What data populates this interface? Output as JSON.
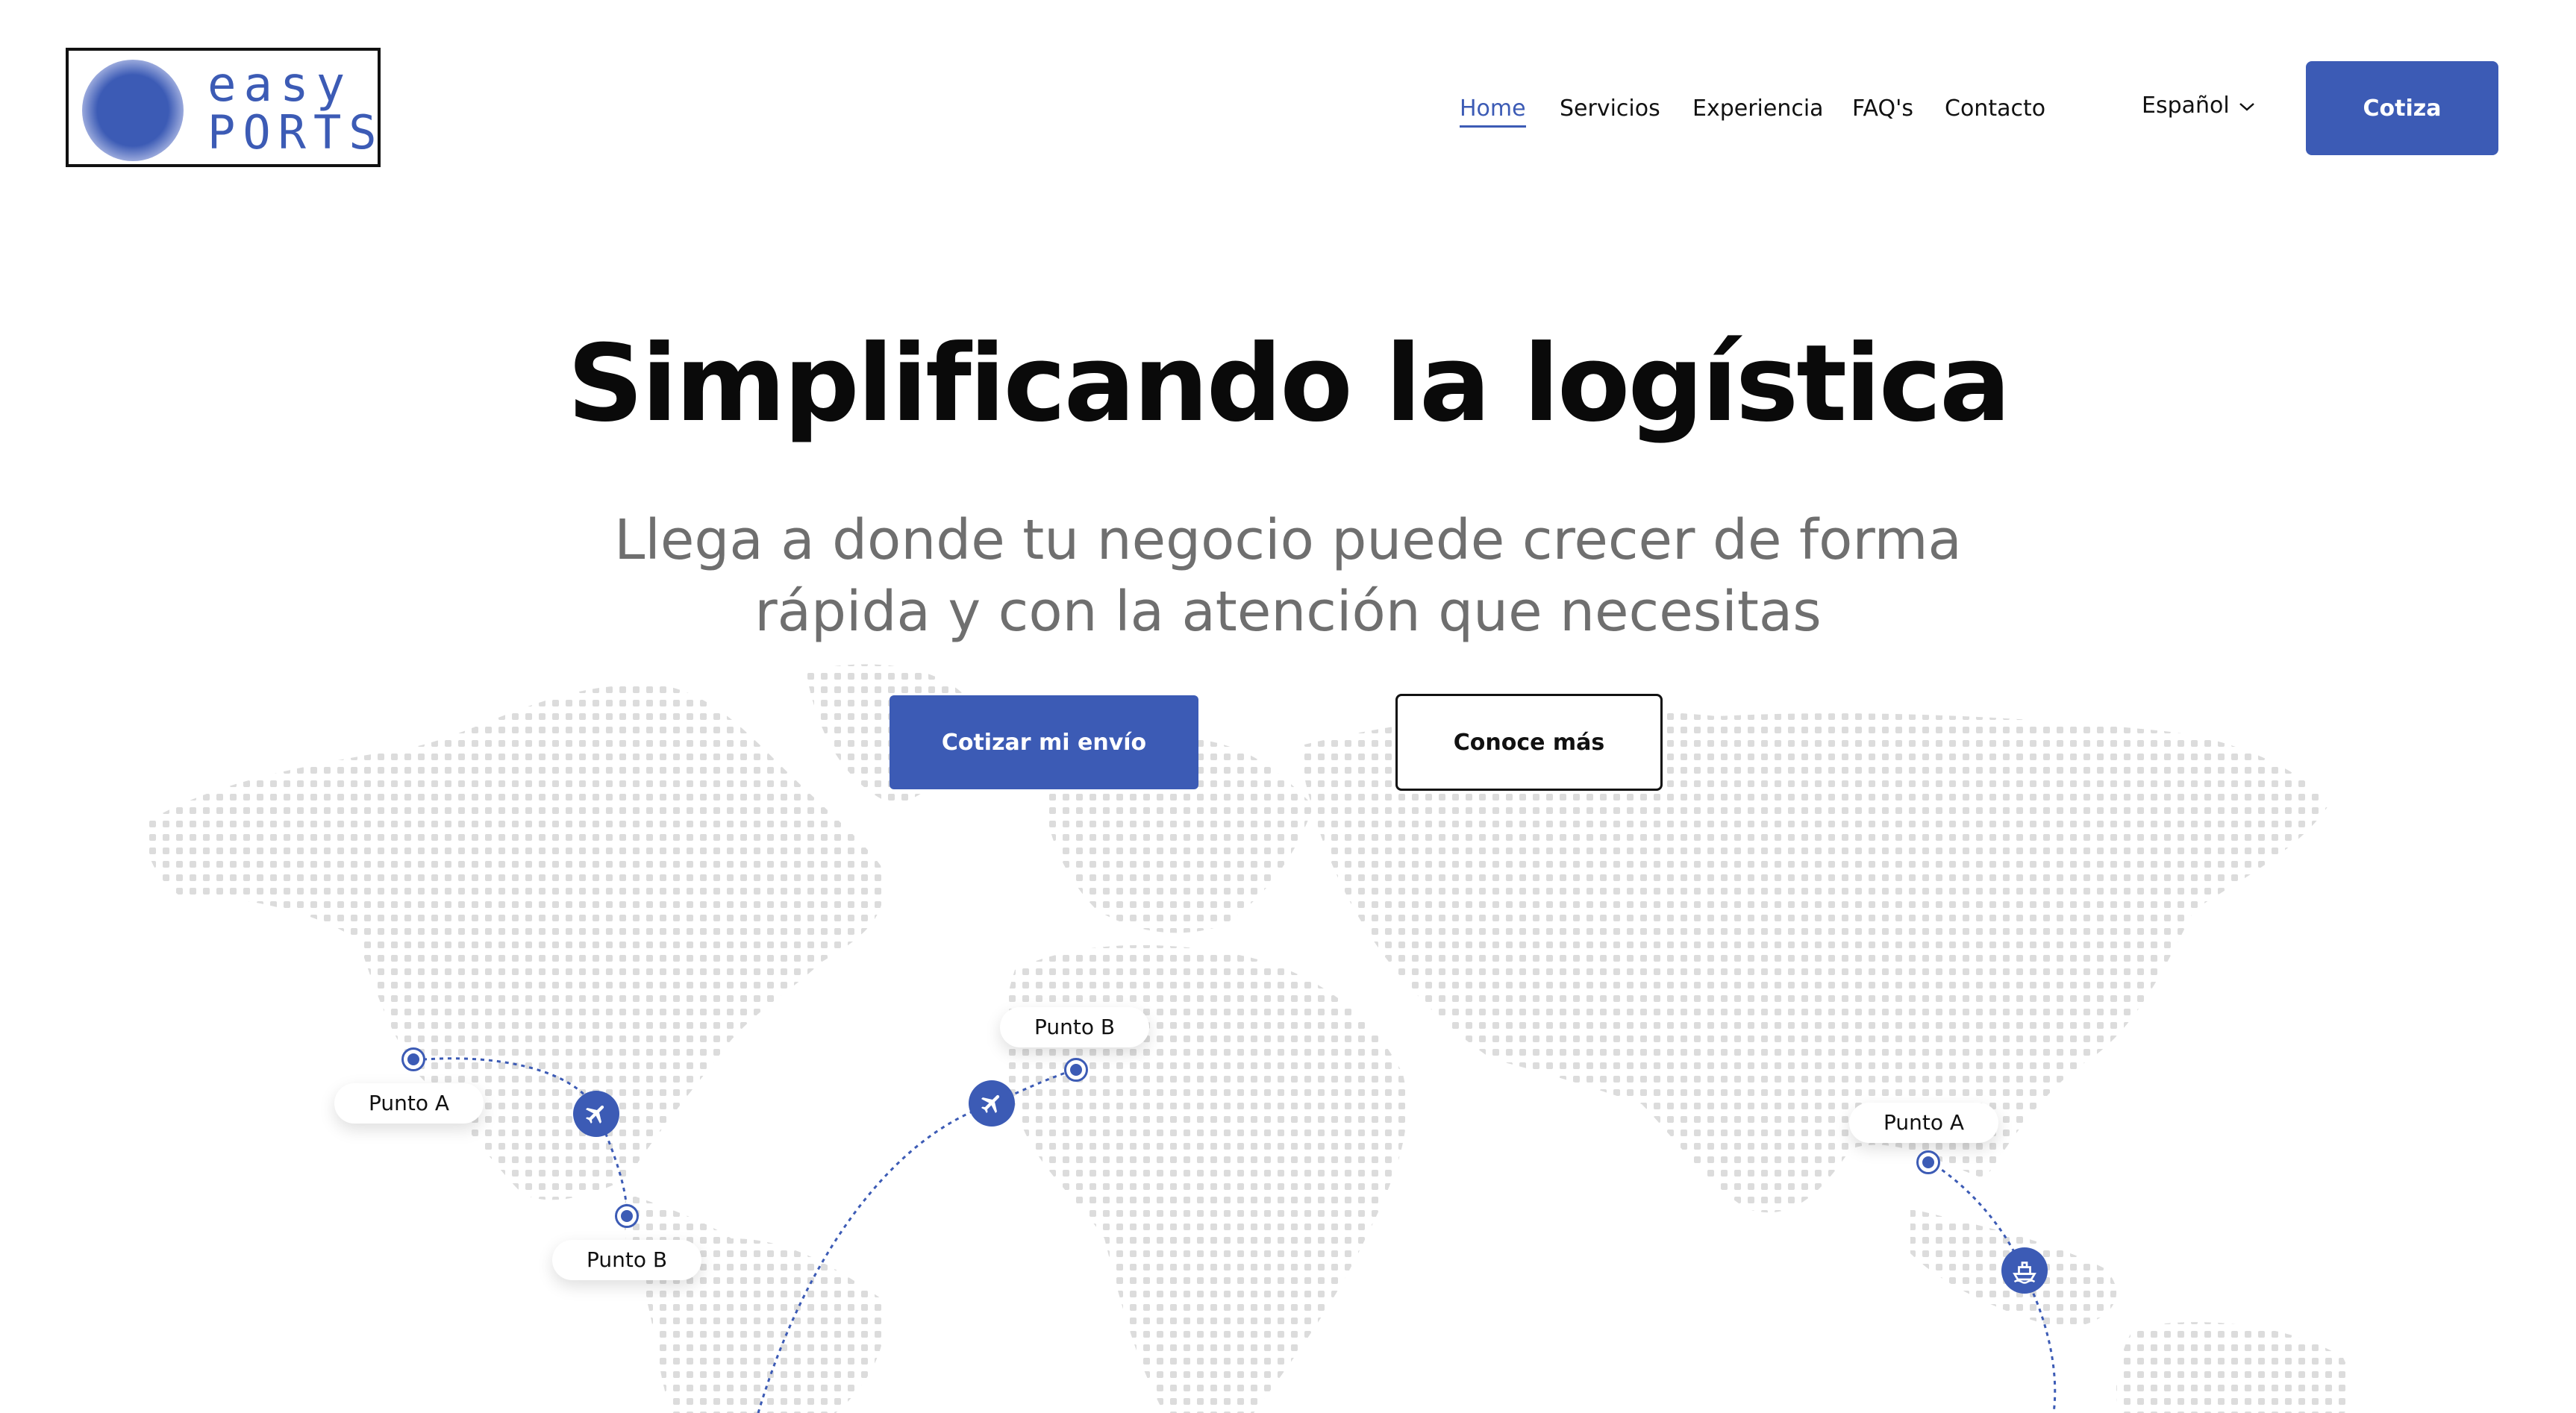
{
  "brand": {
    "logo_line1": "easy",
    "logo_line2": "PORTS",
    "accent_color": "#3c5bb5"
  },
  "nav": {
    "items": [
      {
        "label": "Home",
        "active": true
      },
      {
        "label": "Servicios",
        "active": false
      },
      {
        "label": "Experiencia",
        "active": false
      },
      {
        "label": "FAQ's",
        "active": false
      },
      {
        "label": "Contacto",
        "active": false
      }
    ],
    "language": "Español",
    "language_icon": "chevron-down-icon",
    "cta": "Cotiza"
  },
  "hero": {
    "title": "Simplificando la logística",
    "subtitle": "Llega a donde tu negocio puede crecer de forma rápida y con la atención que necesitas",
    "primary_button": "Cotizar mi envío",
    "secondary_button": "Conoce más"
  },
  "map_routes": {
    "route_1": {
      "origin": "Punto A",
      "destination": "Punto B",
      "icon": "airplane-icon"
    },
    "route_2": {
      "destination": "Punto B",
      "icon": "airplane-icon"
    },
    "route_3": {
      "origin": "Punto A",
      "icon": "ship-icon"
    }
  }
}
